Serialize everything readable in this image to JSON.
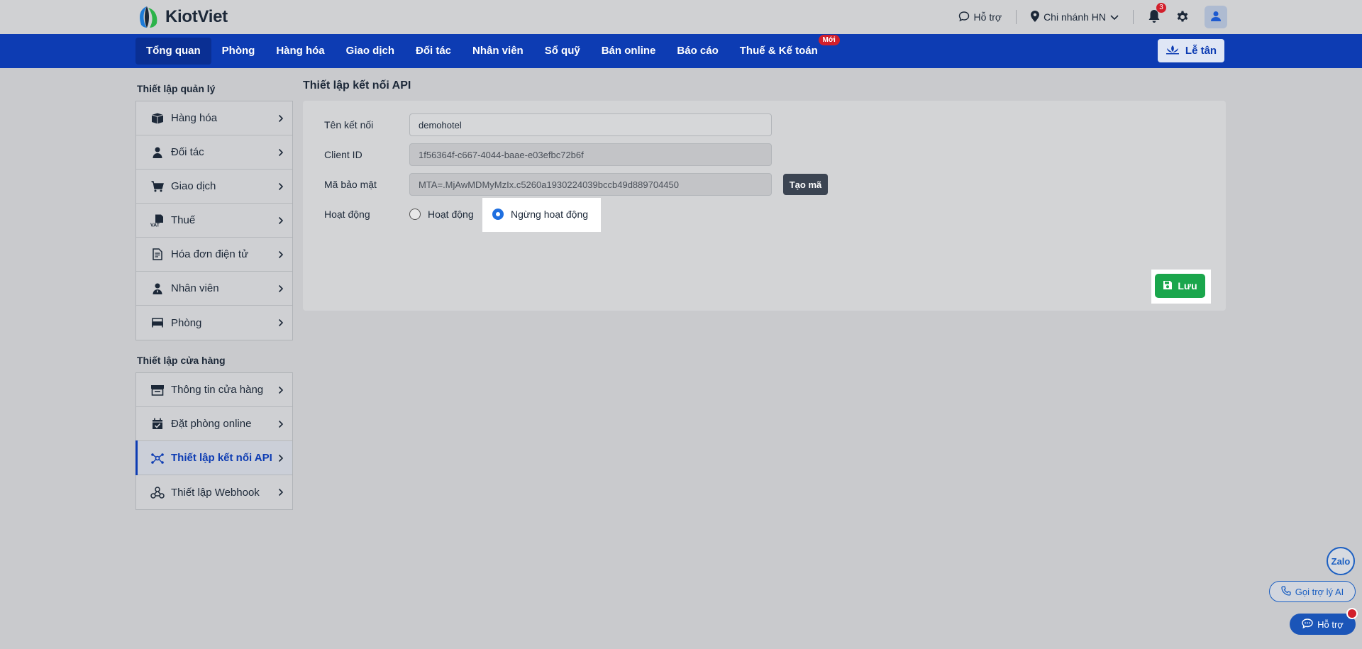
{
  "header": {
    "brand": "KiotViet",
    "support_label": "Hỗ trợ",
    "branch_label": "Chi nhánh HN",
    "notification_count": "3"
  },
  "nav": {
    "items": [
      {
        "label": "Tổng quan",
        "active": true
      },
      {
        "label": "Phòng"
      },
      {
        "label": "Hàng hóa"
      },
      {
        "label": "Giao dịch"
      },
      {
        "label": "Đối tác"
      },
      {
        "label": "Nhân viên"
      },
      {
        "label": "Sổ quỹ"
      },
      {
        "label": "Bán online"
      },
      {
        "label": "Báo cáo"
      },
      {
        "label": "Thuế & Kế toán",
        "badge": "Mới"
      }
    ],
    "reception_label": "Lễ tân"
  },
  "sidebar": {
    "management_title": "Thiết lập quản lý",
    "management_items": [
      {
        "label": "Hàng hóa",
        "icon": "box-icon"
      },
      {
        "label": "Đối tác",
        "icon": "user-icon"
      },
      {
        "label": "Giao dịch",
        "icon": "cart-icon"
      },
      {
        "label": "Thuế",
        "icon": "vat-icon"
      },
      {
        "label": "Hóa đơn điện tử",
        "icon": "invoice-icon"
      },
      {
        "label": "Nhân viên",
        "icon": "staff-icon"
      },
      {
        "label": "Phòng",
        "icon": "bed-icon"
      }
    ],
    "store_title": "Thiết lập cửa hàng",
    "store_items": [
      {
        "label": "Thông tin cửa hàng",
        "icon": "store-icon"
      },
      {
        "label": "Đặt phòng online",
        "icon": "calendar-check-icon"
      },
      {
        "label": "Thiết lập kết nối API",
        "icon": "api-icon",
        "active": true
      },
      {
        "label": "Thiết lập Webhook",
        "icon": "webhook-icon"
      }
    ]
  },
  "page": {
    "title": "Thiết lập kết nối API",
    "form": {
      "name_label": "Tên kết nối",
      "name_value": "demohotel",
      "client_id_label": "Client ID",
      "client_id_value": "1f56364f-c667-4044-baae-e03efbc72b6f",
      "secret_label": "Mã bảo mật",
      "secret_value": "MTA=.MjAwMDMyMzIx.c5260a1930224039bccb49d889704450",
      "generate_label": "Tạo mã",
      "status_label": "Hoạt động",
      "status_options": [
        {
          "label": "Hoạt động",
          "selected": false
        },
        {
          "label": "Ngừng hoạt động",
          "selected": true
        }
      ]
    },
    "save_label": "Lưu"
  },
  "widgets": {
    "zalo_label": "Zalo",
    "ai_label": "Gọi trợ lý AI",
    "help_label": "Hỗ trợ"
  },
  "colors": {
    "nav_bg": "#0d3cb3",
    "save_green": "#1aa64c",
    "badge_red": "#d21f2b",
    "radio_blue": "#1f6fe0"
  }
}
